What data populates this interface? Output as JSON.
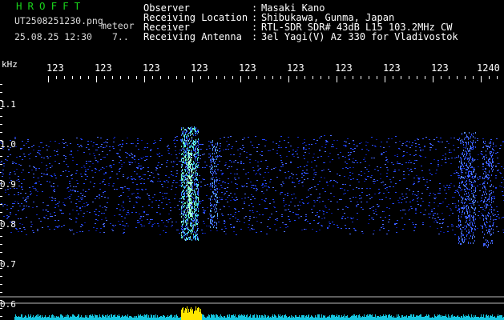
{
  "header": {
    "logo": "HROFFT",
    "filename": "UT2508251230.png",
    "mode": "meteor",
    "datetime": "25.08.25 12:30",
    "interval": "7.."
  },
  "station": {
    "observer_label": "Observer",
    "observer": "Masaki Kano",
    "location_label": "Receiving Location",
    "location": "Shibukawa, Gunma, Japan",
    "receiver_label": "Receiver",
    "receiver": "RTL-SDR SDR# 43dB L15 103.2MHz CW",
    "antenna_label": "Receiving Antenna",
    "antenna": "3el Yagi(V) Az 330 for Vladivostok",
    "separator": ":"
  },
  "axis": {
    "unit": "kHz",
    "y_labels": [
      "1.1",
      "1.0",
      "0.9",
      "0.8",
      "0.7",
      "0.6"
    ],
    "time_labels": [
      "123",
      "123",
      "123",
      "123",
      "123",
      "123",
      "123",
      "123",
      "123",
      "1240"
    ]
  },
  "colors": {
    "background": "#000000",
    "logo": "#19d21b",
    "echo_band": "#2a4cff",
    "meteor_echo": "#5df0c0",
    "level_bar": "#16c6e0",
    "level_peak": "#ffe600",
    "marker_line": "#d9d9d9"
  }
}
